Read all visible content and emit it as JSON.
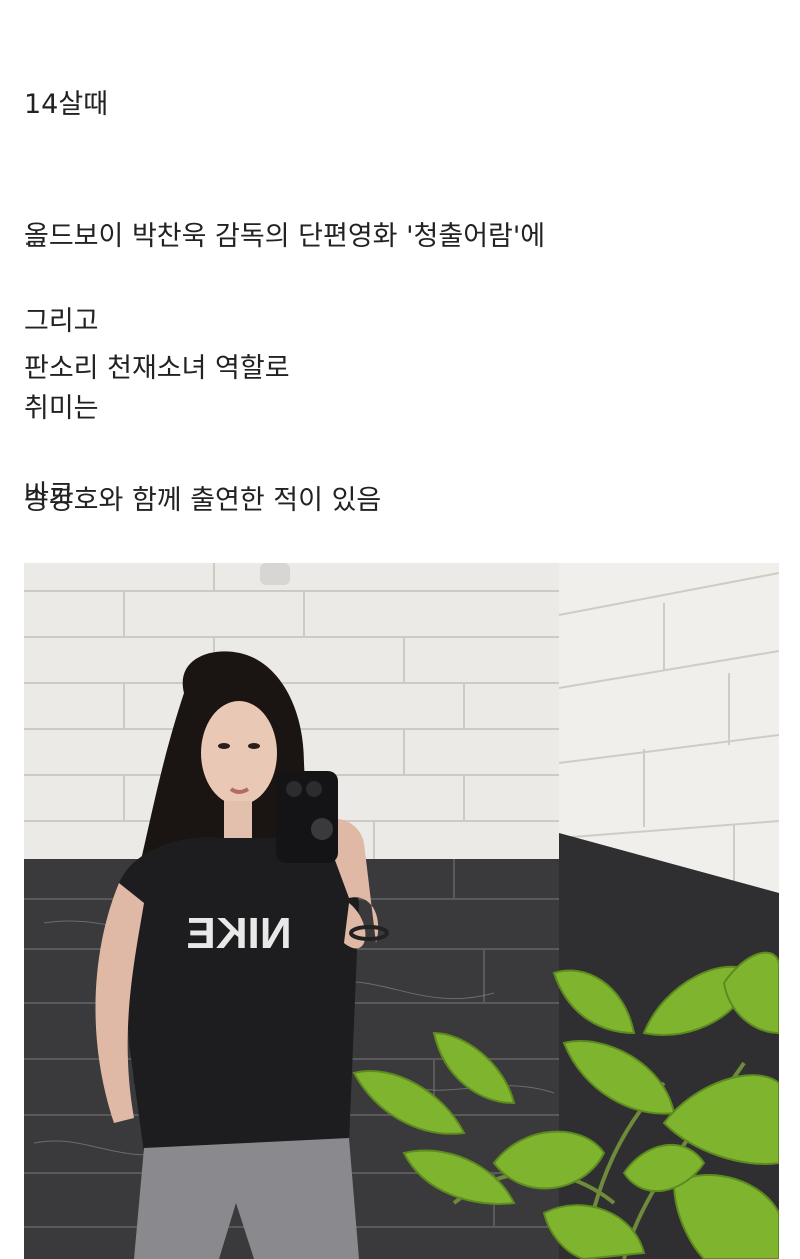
{
  "post": {
    "intro_lines": [
      "14살때",
      "올드보이 박찬욱 감독의 단편영화 '청출어람'에",
      "판소리 천재소녀 역할로",
      "송강호와 함께 출연한 적이 있음"
    ],
    "ellipsis": "...",
    "line_and": "그리고",
    "line_hobby": "취미는",
    "line_is": "바로"
  },
  "photo": {
    "shirt_logo_text": "NIKE",
    "colors": {
      "wall_tile": "#eceae6",
      "grout": "#c9c6c0",
      "marble": "#3a3a3c",
      "shirt": "#1d1d20",
      "leggings": "#8a8a8e",
      "hair": "#1a1412",
      "leaf": "#7fb52e"
    }
  }
}
